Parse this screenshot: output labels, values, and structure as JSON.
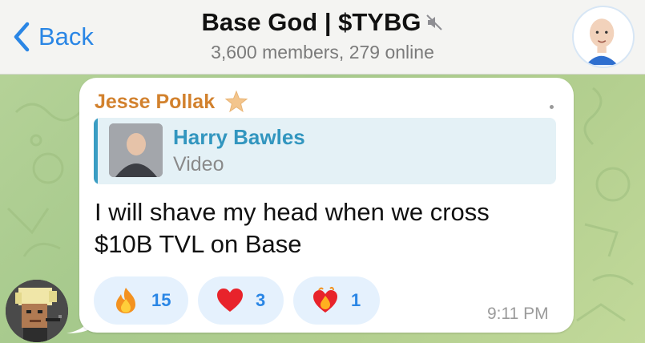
{
  "header": {
    "back_label": "Back",
    "title": "Base God | $TYBG",
    "subtitle": "3,600 members, 279 online",
    "mute_icon": "mute-icon",
    "avatar_icon": "group-avatar"
  },
  "message": {
    "sender": "Jesse Pollak",
    "sender_color": "#d2812d",
    "sender_badge_icon": "star-icon",
    "reply": {
      "name": "Harry Bawles",
      "type": "Video",
      "accent": "#3a9dc3"
    },
    "text_line1": "I will shave my head when we cross",
    "text_line2": "$10B TVL on Base",
    "time": "9:11 PM",
    "reactions": [
      {
        "emoji": "fire-icon",
        "count": "15"
      },
      {
        "emoji": "heart-icon",
        "count": "3"
      },
      {
        "emoji": "heart-on-fire-icon",
        "count": "1"
      }
    ]
  },
  "colors": {
    "accent": "#2a86e5",
    "chat_background": "#a9c98d"
  }
}
